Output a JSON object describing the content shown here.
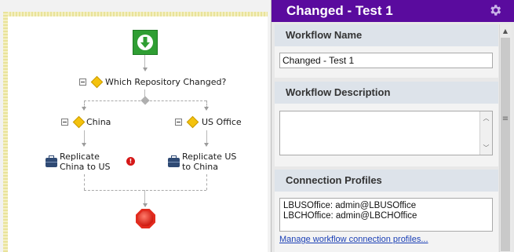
{
  "workflow": {
    "nodes": {
      "decision": "Which Repository Changed?",
      "branch_left": "China",
      "branch_right": "US Office",
      "action_left": "Replicate China to US",
      "action_right": "Replicate US to China"
    }
  },
  "panel": {
    "title": "Changed - Test 1",
    "sections": {
      "name": {
        "label": "Workflow Name",
        "value": "Changed - Test 1"
      },
      "description": {
        "label": "Workflow Description",
        "value": ""
      },
      "profiles": {
        "label": "Connection Profiles",
        "items": [
          "LBUSOffice: admin@LBUSOffice",
          "LBCHOffice: admin@LBCHOffice"
        ],
        "manage_link": "Manage workflow connection profiles..."
      }
    }
  },
  "colors": {
    "header_bg": "#5a0b9e",
    "start_green": "#2f9e33",
    "stop_red": "#e22b1e",
    "decision_yellow": "#f4c20d",
    "error_red": "#d51818",
    "link_blue": "#1a3fb5"
  },
  "icons": [
    "arrow-down-icon",
    "collapse-icon",
    "decision-icon",
    "briefcase-icon",
    "error-icon",
    "stop-icon",
    "gear-icon"
  ]
}
